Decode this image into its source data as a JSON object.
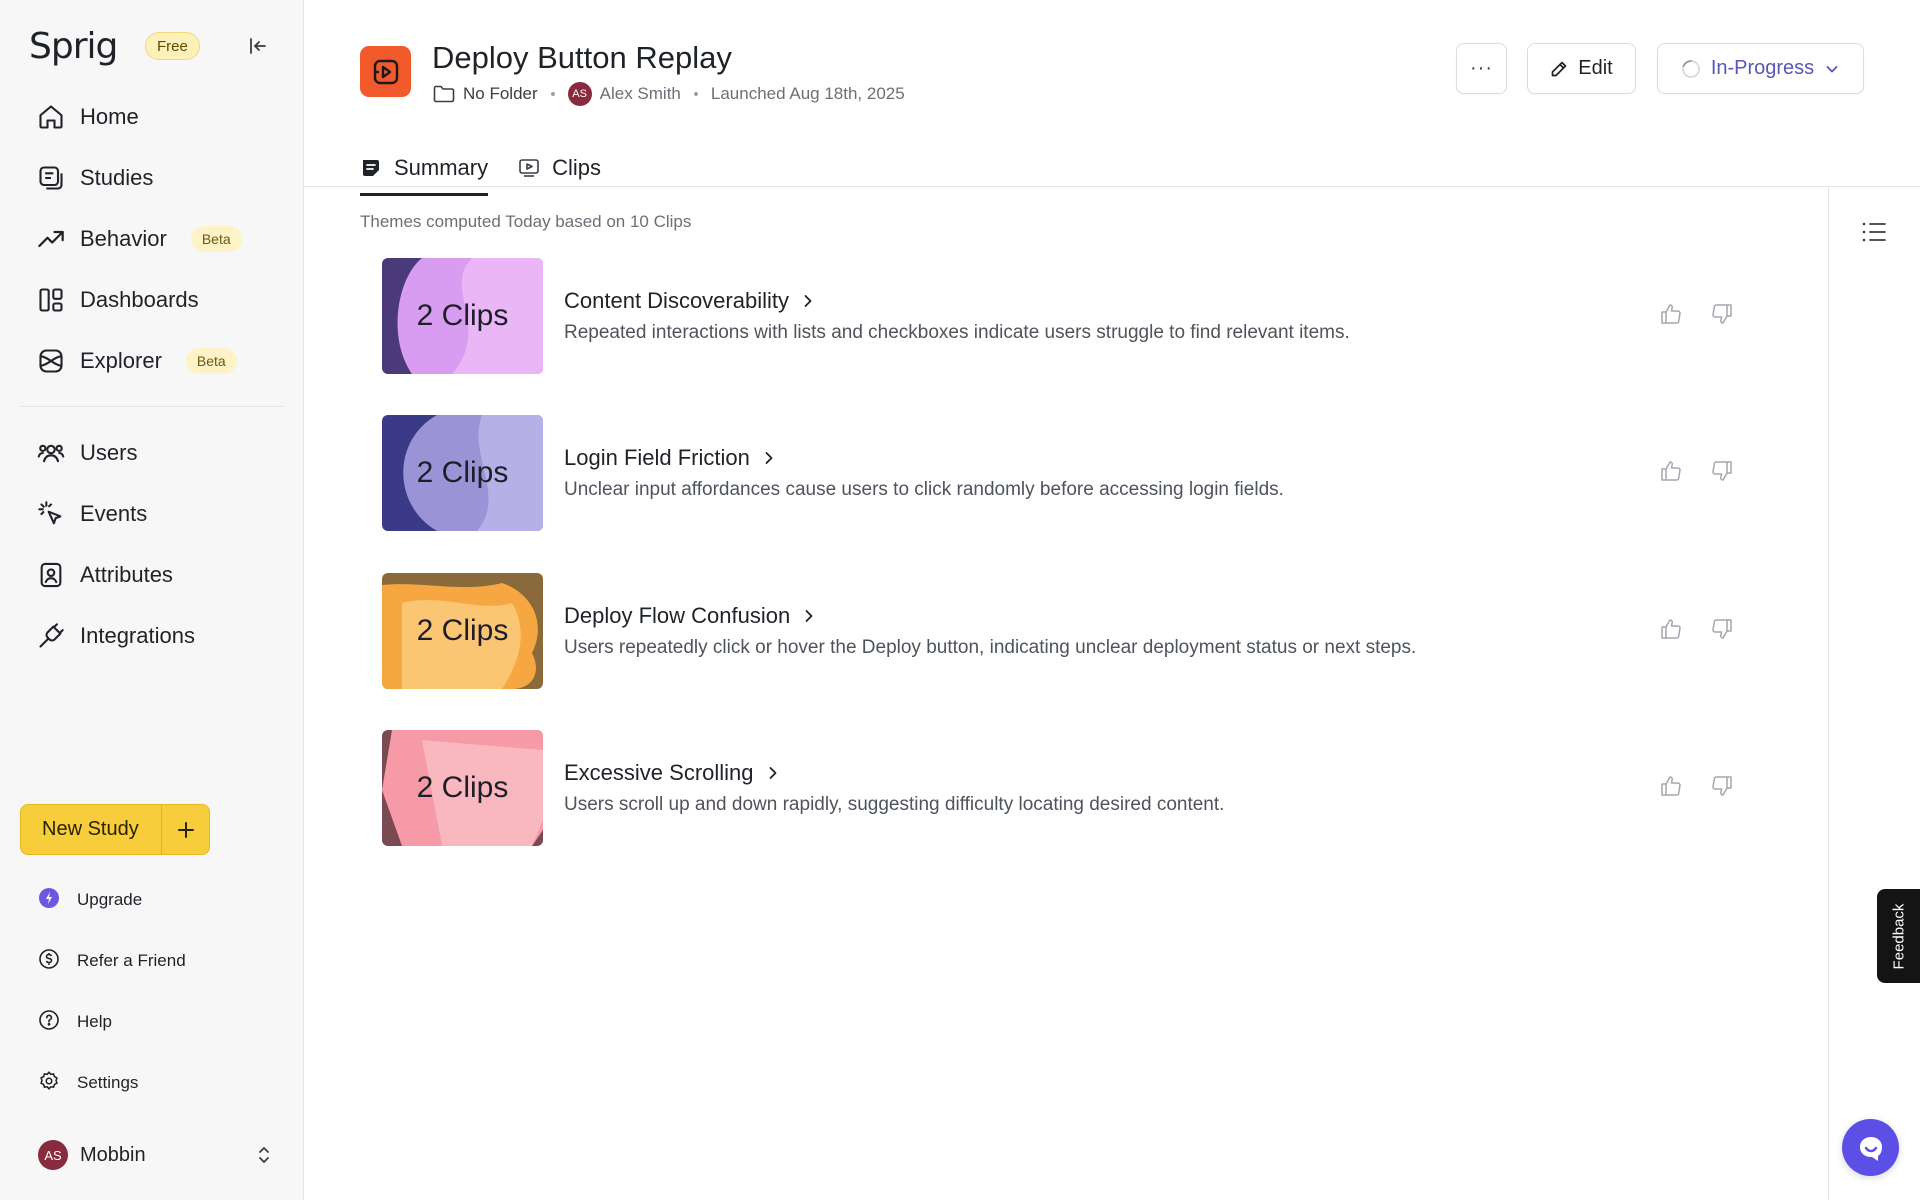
{
  "sidebar": {
    "logo": "Sprig",
    "plan_badge": "Free",
    "nav": [
      {
        "label": "Home",
        "icon": "home-icon"
      },
      {
        "label": "Studies",
        "icon": "studies-icon"
      },
      {
        "label": "Behavior",
        "icon": "trending-icon",
        "badge": "Beta"
      },
      {
        "label": "Dashboards",
        "icon": "dashboards-icon"
      },
      {
        "label": "Explorer",
        "icon": "explorer-icon",
        "badge": "Beta"
      },
      {
        "label": "Users",
        "icon": "users-icon"
      },
      {
        "label": "Events",
        "icon": "events-icon"
      },
      {
        "label": "Attributes",
        "icon": "attributes-icon"
      },
      {
        "label": "Integrations",
        "icon": "integrations-icon"
      }
    ],
    "new_study_label": "New Study",
    "utility": [
      {
        "label": "Upgrade",
        "icon": "upgrade-icon"
      },
      {
        "label": "Refer a Friend",
        "icon": "dollar-icon"
      },
      {
        "label": "Help",
        "icon": "help-icon"
      },
      {
        "label": "Settings",
        "icon": "settings-icon"
      }
    ],
    "user": {
      "initials": "AS",
      "name": "Mobbin"
    }
  },
  "header": {
    "title": "Deploy Button Replay",
    "folder": "No Folder",
    "owner_initials": "AS",
    "owner": "Alex Smith",
    "launched": "Launched Aug 18th, 2025",
    "more_label": "···",
    "edit_label": "Edit",
    "status_label": "In-Progress"
  },
  "tabs": [
    {
      "label": "Summary",
      "active": true
    },
    {
      "label": "Clips",
      "active": false
    }
  ],
  "themes_note": "Themes computed Today based on 10 Clips",
  "themes": [
    {
      "clips": "2 Clips",
      "name": "Content Discoverability",
      "description": "Repeated interactions with lists and checkboxes indicate users struggle to find relevant items.",
      "colors": [
        "#4a3a7a",
        "#d89cf0",
        "#efbdf6"
      ]
    },
    {
      "clips": "2 Clips",
      "name": "Login Field Friction",
      "description": "Unclear input affordances cause users to click randomly before accessing login fields.",
      "colors": [
        "#3a3a86",
        "#9a94d6",
        "#bdb6ea"
      ]
    },
    {
      "clips": "2 Clips",
      "name": "Deploy Flow Confusion",
      "description": "Users repeatedly click or hover the Deploy button, indicating unclear deployment status or next steps.",
      "colors": [
        "#8a6a3a",
        "#f7a742",
        "#fcd38a"
      ]
    },
    {
      "clips": "2 Clips",
      "name": "Excessive Scrolling",
      "description": "Users scroll up and down rapidly, suggesting difficulty locating desired content.",
      "colors": [
        "#7a4a52",
        "#f59aa6",
        "#fbc3cb"
      ]
    }
  ],
  "feedback_label": "Feedback",
  "colors": {
    "accent": "#f7cd3c",
    "brand_orange": "#f25a2b",
    "chat": "#5b4fe6",
    "status": "#5a56b8"
  }
}
